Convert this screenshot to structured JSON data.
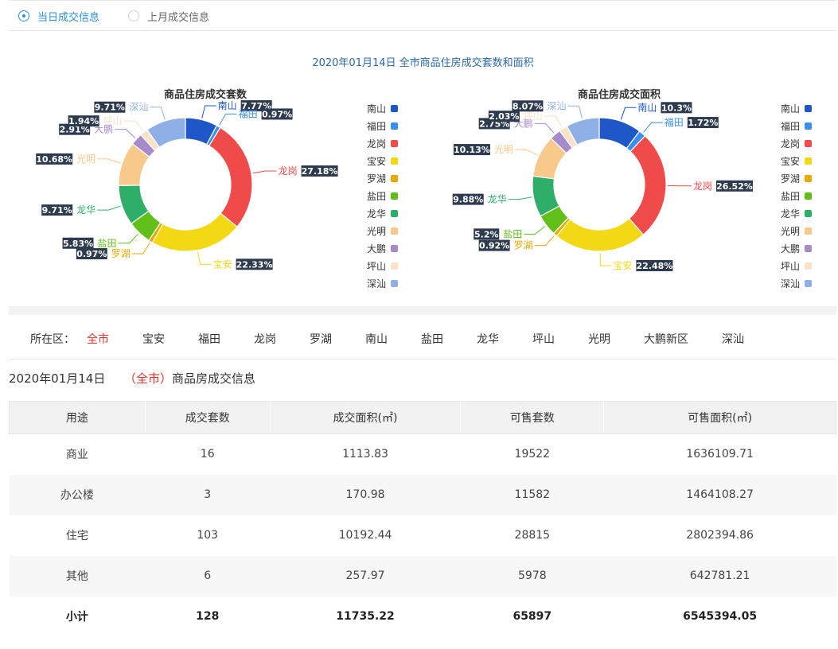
{
  "radio": {
    "today": "当日成交信息",
    "month": "上月成交信息"
  },
  "charts_title": "2020年01月14日 全市商品住房成交套数和面积",
  "chart_data": [
    {
      "type": "pie",
      "title": "商品住房成交套数",
      "slices": [
        {
          "name": "南山",
          "value": 7.77,
          "label": "7.77%"
        },
        {
          "name": "福田",
          "value": 0.97,
          "label": "0.97%"
        },
        {
          "name": "龙岗",
          "value": 27.18,
          "label": "27.18%"
        },
        {
          "name": "宝安",
          "value": 22.33,
          "label": "22.33%"
        },
        {
          "name": "罗湖",
          "value": 0.97,
          "label": "0.97%"
        },
        {
          "name": "盐田",
          "value": 5.83,
          "label": "5.83%"
        },
        {
          "name": "龙华",
          "value": 9.71,
          "label": "9.71%"
        },
        {
          "name": "光明",
          "value": 10.68,
          "label": "10.68%"
        },
        {
          "name": "大鹏",
          "value": 2.91,
          "label": "2.91%"
        },
        {
          "name": "坪山",
          "value": 1.94,
          "label": "1.94%"
        },
        {
          "name": "深汕",
          "value": 9.71,
          "label": "9.71%"
        }
      ],
      "legend": [
        "南山",
        "福田",
        "龙岗",
        "宝安",
        "罗湖",
        "盐田",
        "龙华",
        "光明",
        "大鹏",
        "坪山",
        "深汕"
      ]
    },
    {
      "type": "pie",
      "title": "商品住房成交面积",
      "slices": [
        {
          "name": "南山",
          "value": 10.3,
          "label": "10.3%"
        },
        {
          "name": "福田",
          "value": 1.72,
          "label": "1.72%"
        },
        {
          "name": "龙岗",
          "value": 26.52,
          "label": "26.52%"
        },
        {
          "name": "宝安",
          "value": 22.48,
          "label": "22.48%"
        },
        {
          "name": "罗湖",
          "value": 0.92,
          "label": "0.92%"
        },
        {
          "name": "盐田",
          "value": 5.2,
          "label": "5.2%"
        },
        {
          "name": "龙华",
          "value": 9.88,
          "label": "9.88%"
        },
        {
          "name": "光明",
          "value": 10.13,
          "label": "10.13%"
        },
        {
          "name": "大鹏",
          "value": 2.75,
          "label": "2.75%"
        },
        {
          "name": "坪山",
          "value": 2.03,
          "label": "2.03%"
        },
        {
          "name": "深汕",
          "value": 8.07,
          "label": "8.07%"
        }
      ],
      "legend": [
        "南山",
        "福田",
        "龙岗",
        "宝安",
        "罗湖",
        "盐田",
        "龙华",
        "光明",
        "大鹏",
        "坪山",
        "深汕"
      ]
    }
  ],
  "colors": {
    "南山": "#1f57c8",
    "福田": "#3a8ff0",
    "龙岗": "#ef4b4b",
    "宝安": "#f3d816",
    "罗湖": "#e8a800",
    "盐田": "#62bf1a",
    "龙华": "#2fae6a",
    "光明": "#f7c98a",
    "大鹏": "#a78bc9",
    "坪山": "#f8e3c8",
    "深汕": "#8fb0e6"
  },
  "district_filter": {
    "label": "所在区：",
    "items": [
      "全市",
      "宝安",
      "福田",
      "龙岗",
      "罗湖",
      "南山",
      "盐田",
      "龙华",
      "坪山",
      "光明",
      "大鹏新区",
      "深汕"
    ],
    "active": "全市"
  },
  "info": {
    "date": "2020年01月14日",
    "open_paren": "（",
    "district": "全市",
    "close_paren": "）",
    "suffix": "商品房成交信息"
  },
  "table": {
    "headers": [
      "用途",
      "成交套数",
      "成交面积(㎡)",
      "可售套数",
      "可售面积(㎡)"
    ],
    "rows": [
      [
        "商业",
        "16",
        "1113.83",
        "19522",
        "1636109.71"
      ],
      [
        "办公楼",
        "3",
        "170.98",
        "11582",
        "1464108.27"
      ],
      [
        "住宅",
        "103",
        "10192.44",
        "28815",
        "2802394.86"
      ],
      [
        "其他",
        "6",
        "257.97",
        "5978",
        "642781.21"
      ],
      [
        "小计",
        "128",
        "11735.22",
        "65897",
        "6545394.05"
      ]
    ]
  }
}
